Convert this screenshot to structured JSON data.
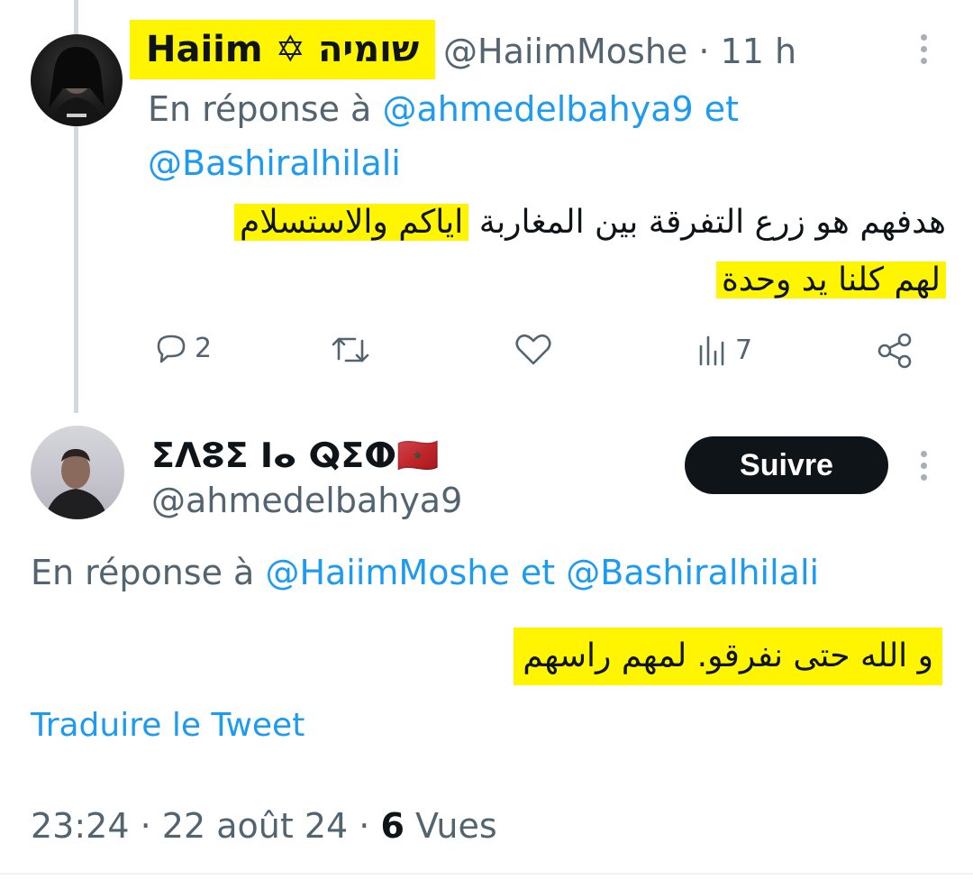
{
  "tweet1": {
    "display_name": "Haiim ✡ שומיה",
    "handle": "@HaiimMoshe",
    "separator": "·",
    "time": "11 h",
    "reply_prefix": "En réponse à",
    "reply_user1": "@ahmedelbahya9",
    "reply_and": "et",
    "reply_user2": "@Bashiralhilali",
    "text_line1_plain": "هدفهم هو زرع التفرقة بين المغاربة",
    "text_line1_hl": "اياكم والاستسلام",
    "text_line2_hl": "لهم كلنا يد وحدة",
    "replies_count": "2",
    "views_count": "7",
    "icons": {
      "reply": "reply-icon",
      "retweet": "retweet-icon",
      "like": "heart-icon",
      "views": "views-icon",
      "share": "share-icon",
      "more": "more-icon"
    }
  },
  "tweet2": {
    "display_name": "ⵉⴷⵓⵉ ⵏⴰ ⵕⵉⵀ🇲🇦",
    "handle": "@ahmedelbahya9",
    "follow_label": "Suivre",
    "reply_prefix": "En réponse à",
    "reply_user1": "@HaiimMoshe",
    "reply_and": "et",
    "reply_user2": "@Bashiralhilali",
    "text_hl": "و الله حتى نفرقو. لمهم راسهم",
    "translate_label": "Traduire le Tweet",
    "time": "23:24",
    "separator": "·",
    "date": "22 août 24",
    "views_count": "6",
    "views_label": "Vues"
  },
  "colors": {
    "accent": "#1d9bf0",
    "highlight": "#fff500",
    "text": "#0f1419",
    "muted": "#536471"
  }
}
